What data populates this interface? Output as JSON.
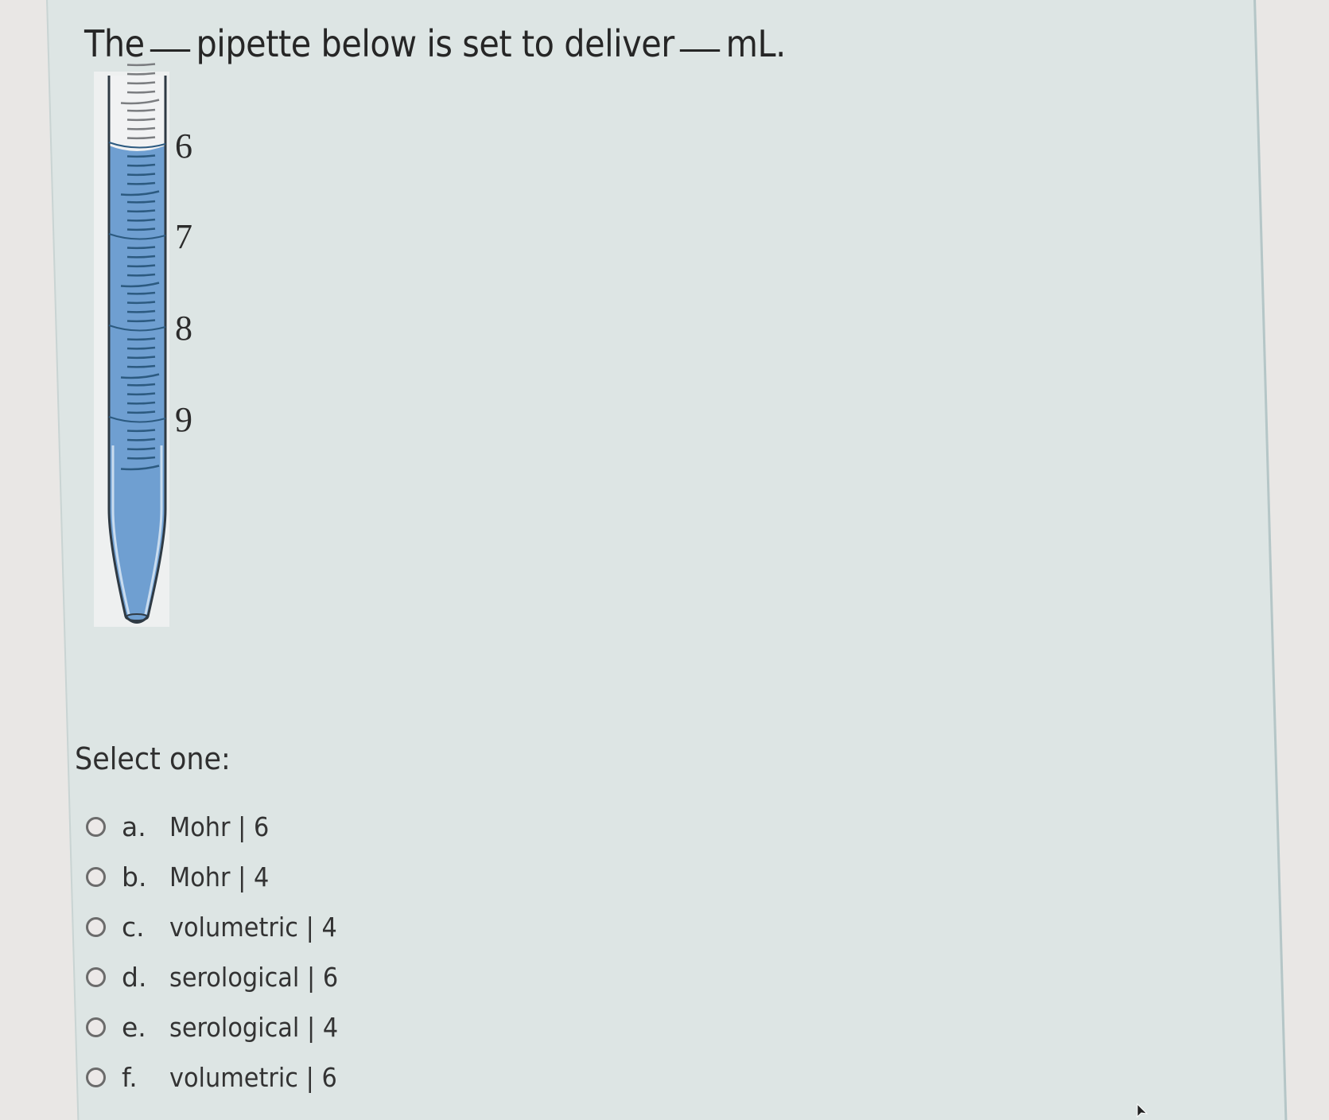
{
  "question": {
    "prefix": "The",
    "middle": "pipette below is set to deliver",
    "suffix": "mL."
  },
  "figure": {
    "type": "pipette-illustration",
    "scale_labels": [
      "6",
      "7",
      "8",
      "9"
    ],
    "fluid_level_ml": 6,
    "fluid_color": "#6f9fd1"
  },
  "prompt": "Select one:",
  "options": [
    {
      "letter": "a.",
      "label": "Mohr | 6",
      "selected": false
    },
    {
      "letter": "b.",
      "label": "Mohr | 4",
      "selected": false
    },
    {
      "letter": "c.",
      "label": "volumetric | 4",
      "selected": false
    },
    {
      "letter": "d.",
      "label": "serological | 6",
      "selected": false
    },
    {
      "letter": "e.",
      "label": "serological | 4",
      "selected": false
    },
    {
      "letter": "f.",
      "label": "volumetric | 6",
      "selected": false
    }
  ],
  "colors": {
    "panel_bg": "#dde5e4",
    "text": "#262626"
  }
}
